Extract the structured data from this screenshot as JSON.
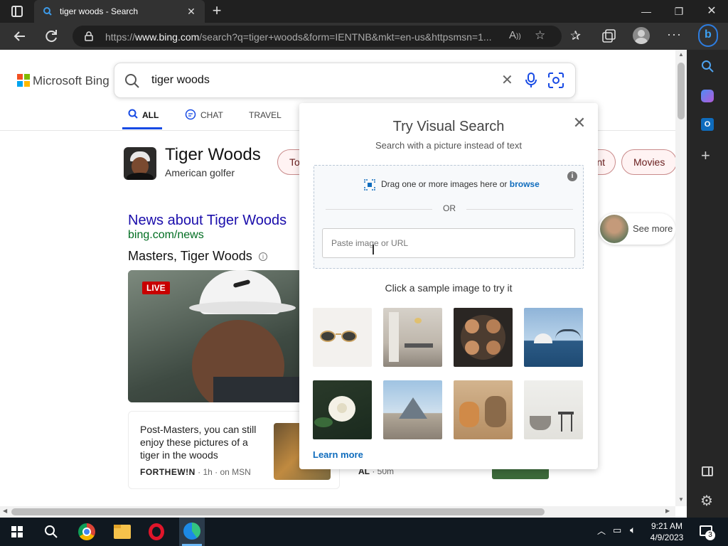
{
  "browser": {
    "tab_title": "tiger woods - Search",
    "url_prefix": "https://",
    "url_domain": "www.bing.com",
    "url_rest": "/search?q=tiger+woods&form=IENTNB&mkt=en-us&httpsmsn=1..."
  },
  "bing": {
    "logo_text": "Microsoft Bing",
    "query": "tiger woods",
    "nav": [
      {
        "label": "ALL"
      },
      {
        "label": "CHAT"
      },
      {
        "label": "TRAVEL"
      }
    ]
  },
  "entity": {
    "name": "Tiger Woods",
    "description": "American golfer",
    "pills": [
      "To",
      "nt",
      "Movies"
    ]
  },
  "news": {
    "title": "News about Tiger Woods",
    "url": "bing.com/news",
    "subtitle": "Masters, Tiger Woods",
    "live_badge": "LIVE",
    "card1": {
      "text": "Post-Masters, you can still enjoy these pictures of a tiger in the woods",
      "source": "FORTHEW!N",
      "meta": " · 1h · on MSN"
    },
    "card2": {
      "source": "AL",
      "meta": " · 50m"
    },
    "see_more": "See more"
  },
  "visual_search": {
    "title": "Try Visual Search",
    "subtitle": "Search with a picture instead of text",
    "drag_text": "Drag one or more images here or ",
    "browse": "browse",
    "or": "OR",
    "paste_placeholder": "Paste image or URL",
    "sample_label": "Click a sample image to try it",
    "samples": [
      "sunglasses",
      "dining room",
      "latte art",
      "sydney opera house",
      "white rose",
      "louvre pyramid",
      "dogs",
      "chair"
    ],
    "learn_more": "Learn more"
  },
  "taskbar": {
    "time": "9:21 AM",
    "date": "4/9/2023",
    "notification_count": "3"
  }
}
